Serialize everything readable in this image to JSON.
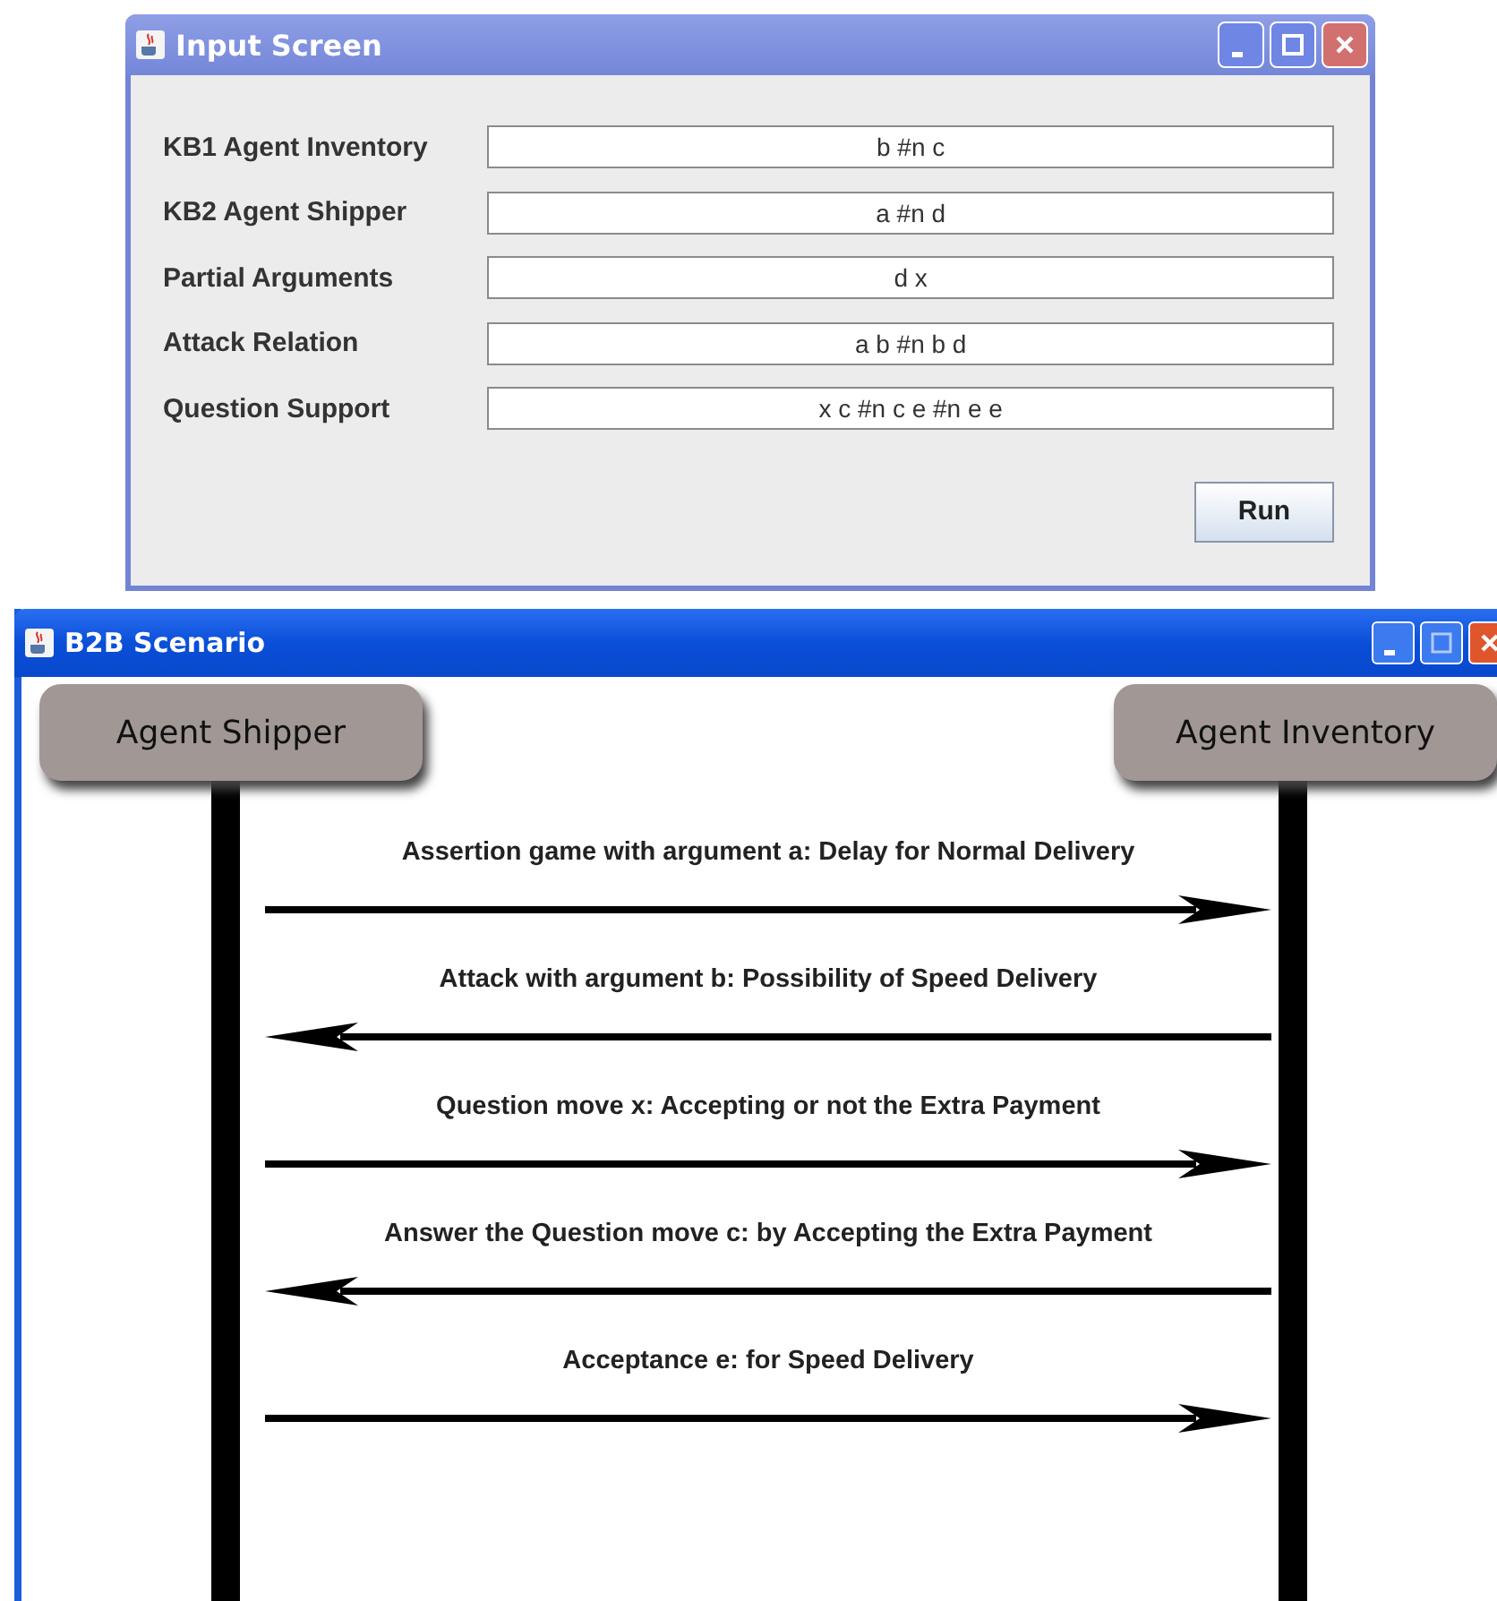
{
  "input_window": {
    "title": "Input Screen",
    "fields": [
      {
        "label": "KB1 Agent Inventory",
        "value": "b #n c"
      },
      {
        "label": "KB2 Agent Shipper",
        "value": "a #n d"
      },
      {
        "label": "Partial Arguments",
        "value": "d x"
      },
      {
        "label": "Attack Relation",
        "value": "a b #n b d"
      },
      {
        "label": "Question Support",
        "value": "x c #n c e #n e e"
      }
    ],
    "button": "Run"
  },
  "scenario_window": {
    "title": "B2B Scenario",
    "agents": [
      {
        "name": "Agent Shipper"
      },
      {
        "name": "Agent Inventory"
      }
    ],
    "messages": [
      {
        "label": "Assertion game with argument a: Delay for Normal Delivery",
        "kind": "rightward"
      },
      {
        "label": "Attack with argument b: Possibility of Speed Delivery",
        "kind": "leftward"
      },
      {
        "label": "Question move x: Accepting or not the Extra Payment",
        "kind": "rightward"
      },
      {
        "label": "Answer the Question move c: by Accepting the Extra Payment",
        "kind": "leftward"
      },
      {
        "label": "Acceptance e: for Speed Delivery",
        "kind": "rightward"
      }
    ]
  }
}
